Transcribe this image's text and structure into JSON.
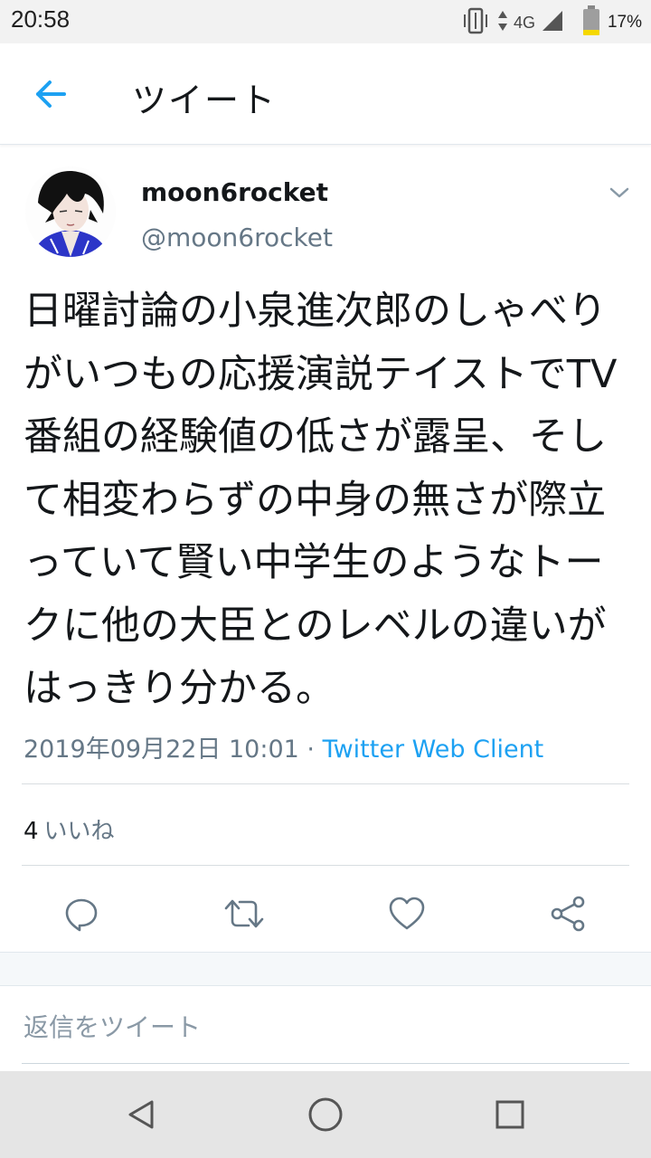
{
  "status_bar": {
    "time": "20:58",
    "network": "4G",
    "battery": "17%"
  },
  "header": {
    "title": "ツイート",
    "back_icon": "arrow-left-icon",
    "accent_color": "#1da1f2"
  },
  "tweet": {
    "author_name": "moon6rocket",
    "author_handle": "@moon6rocket",
    "text_lines": [
      "日曜討論の小泉進次郎のしゃべり",
      "がいつもの応援演説テイストでTV",
      "番組の経験値の低さが露呈、そし",
      "て相変わらずの中身の無さが際立",
      "っていて賢い中学生のようなトー",
      "クに他の大臣とのレベルの違いが",
      "はっきり分かる。"
    ],
    "timestamp": "2019年09月22日 10:01",
    "separator": " · ",
    "client": "Twitter Web Client",
    "likes_count": "4",
    "likes_label": "いいね"
  },
  "actions": [
    {
      "name": "reply-icon"
    },
    {
      "name": "retweet-icon"
    },
    {
      "name": "like-icon"
    },
    {
      "name": "share-icon"
    }
  ],
  "reply": {
    "placeholder": "返信をツイート"
  },
  "nav_bar": {
    "buttons": [
      "back-triangle-icon",
      "home-circle-icon",
      "recents-square-icon"
    ]
  }
}
